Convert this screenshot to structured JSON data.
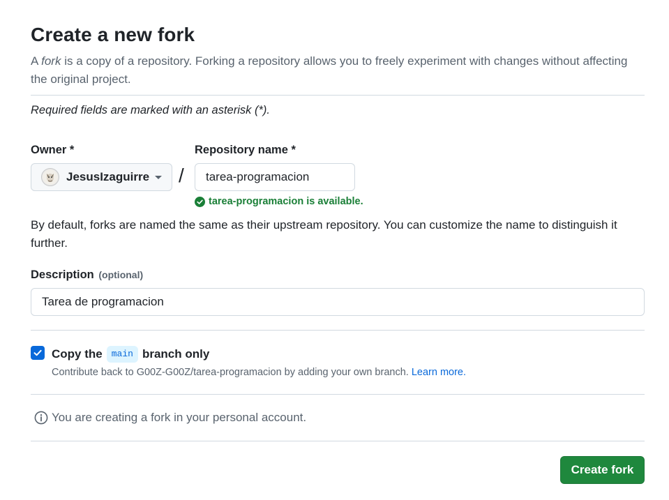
{
  "header": {
    "title": "Create a new fork",
    "subtitle_prefix": "A ",
    "subtitle_em": "fork",
    "subtitle_rest": " is a copy of a repository. Forking a repository allows you to freely experiment with changes without affecting the original project."
  },
  "form": {
    "required_note": "Required fields are marked with an asterisk (*).",
    "owner": {
      "label": "Owner *",
      "value": "JesusIzaguirre"
    },
    "separator": "/",
    "repo_name": {
      "label": "Repository name *",
      "value": "tarea-programacion",
      "availability": "tarea-programacion is available."
    },
    "default_note": "By default, forks are named the same as their upstream repository. You can customize the name to distinguish it further.",
    "description": {
      "label": "Description",
      "optional": "(optional)",
      "value": "Tarea de programacion"
    },
    "copy_branch": {
      "checked": true,
      "label_prefix": "Copy the",
      "branch": "main",
      "label_suffix": "branch only",
      "help_text": "Contribute back to G00Z-G00Z/tarea-programacion by adding your own branch.",
      "learn_more": "Learn more."
    },
    "info": "You are creating a fork in your personal account.",
    "submit_label": "Create fork"
  },
  "colors": {
    "accent": "#0969da",
    "success": "#1a7f37",
    "primary_button": "#1f883d",
    "muted_text": "#59636e",
    "border": "#d1d9e0"
  }
}
